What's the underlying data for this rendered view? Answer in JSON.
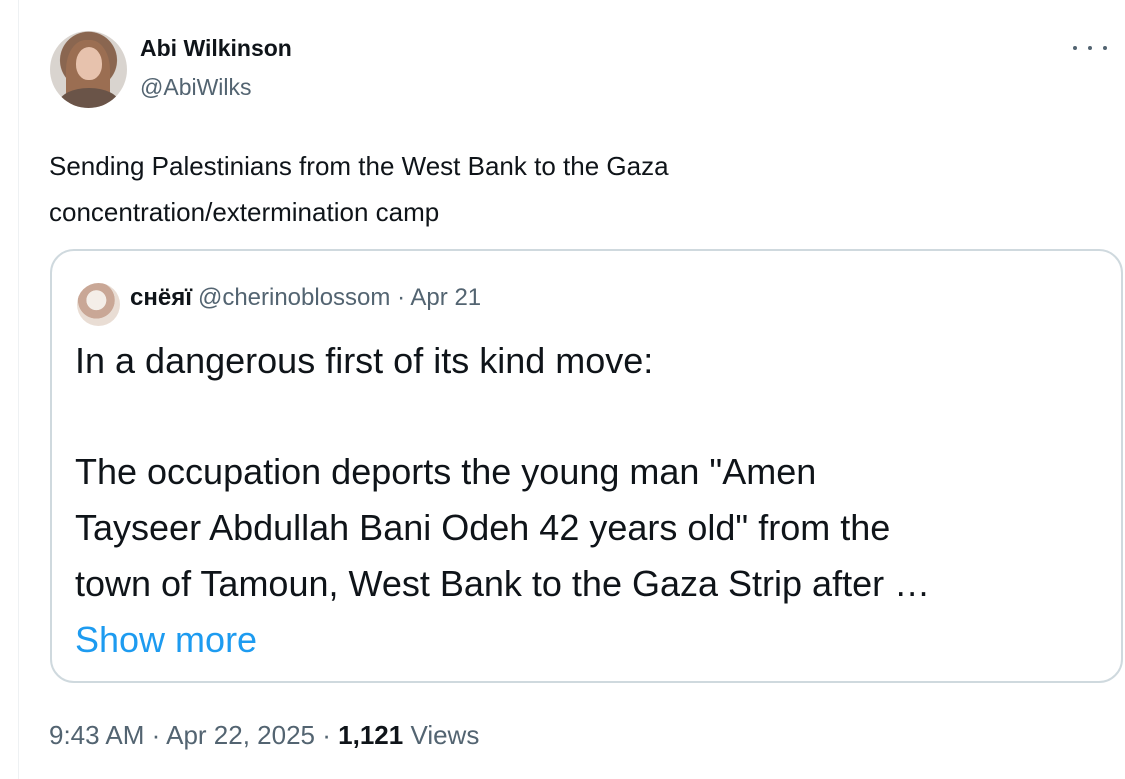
{
  "tweet": {
    "author": {
      "name": "Abi Wilkinson",
      "handle": "@AbiWilks"
    },
    "text_lines": [
      "Sending Palestinians from the West Bank to the Gaza",
      "concentration/extermination camp"
    ],
    "quoted": {
      "name": "снёяї",
      "handle": "@cherinoblossom",
      "separator": "·",
      "date": "Apr 21",
      "lines": [
        "In a dangerous first of its kind move:",
        "The occupation deports the young man \"Amen",
        "Tayseer Abdullah Bani Odeh 42 years old\" from the",
        "town of Tamoun, West Bank to the Gaza Strip after …"
      ],
      "show_more": "Show more"
    },
    "meta": {
      "time": "9:43 AM",
      "date": "Apr 22, 2025",
      "separator": "·",
      "views_count": "1,121",
      "views_label": "Views"
    }
  }
}
